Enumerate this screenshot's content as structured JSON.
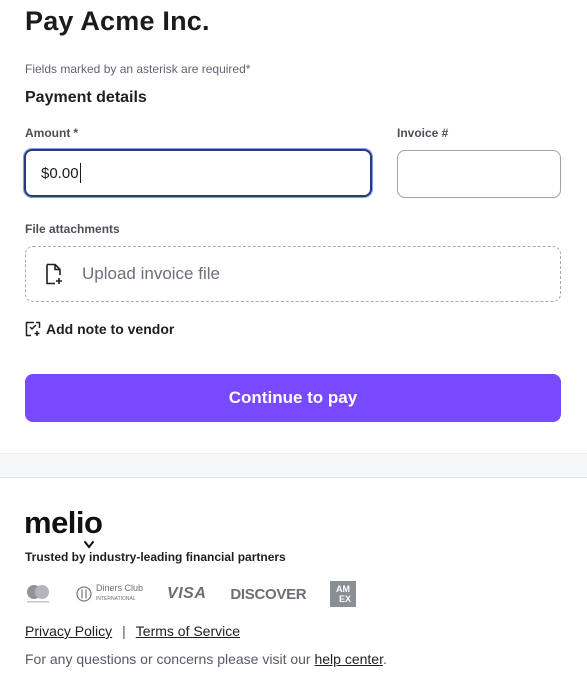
{
  "header": {
    "title": "Pay Acme Inc.",
    "required_note": "Fields marked by an asterisk are required*"
  },
  "payment": {
    "section_title": "Payment details",
    "amount": {
      "label": "Amount",
      "asterisk": "*",
      "value": "$0.00"
    },
    "invoice": {
      "label": "Invoice #",
      "value": ""
    },
    "attachments": {
      "label": "File attachments",
      "upload_text": "Upload invoice file"
    },
    "add_note_label": "Add note to vendor",
    "continue_label": "Continue to pay"
  },
  "footer": {
    "brand": "melio",
    "trusted_text": "Trusted by industry-leading financial partners",
    "cards": {
      "mastercard_icon": "mastercard-icon",
      "diners_label": "Diners Club",
      "diners_sub": "INTERNATIONAL",
      "visa_label": "VISA",
      "discover_label": "DISCOVER",
      "amex_label": "AM EX"
    },
    "links": {
      "privacy": "Privacy Policy",
      "separator": "|",
      "terms": "Terms of Service"
    },
    "help": {
      "prefix": "For any questions or concerns please visit our ",
      "link": "help center",
      "suffix": "."
    }
  },
  "colors": {
    "accent": "#7849ff",
    "focus_border": "#2a3a78",
    "band": "#f6f7f9"
  }
}
